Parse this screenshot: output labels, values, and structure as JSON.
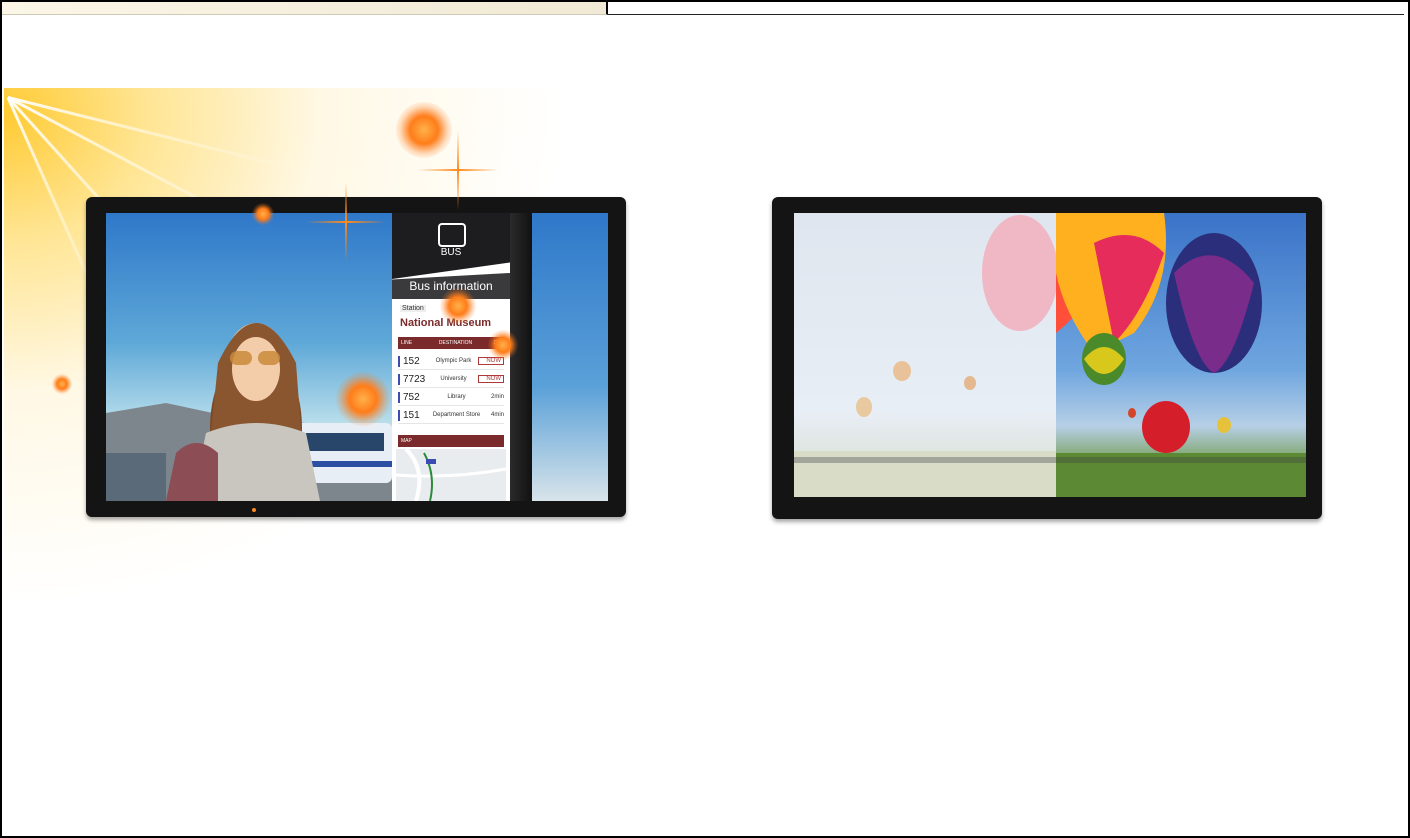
{
  "bus_screen": {
    "icon_label": "BUS",
    "title": "Bus information",
    "station_label": "Station",
    "station_name": "National Museum",
    "columns": [
      "LINE",
      "DESTINATION",
      "DUE"
    ],
    "rows": [
      {
        "line": "152",
        "destination": "Olympic Park",
        "due": "NOW"
      },
      {
        "line": "7723",
        "destination": "University",
        "due": "NOW"
      },
      {
        "line": "752",
        "destination": "Library",
        "due": "2min"
      },
      {
        "line": "151",
        "destination": "Department Store",
        "due": "4min"
      }
    ],
    "map_label": "MAP"
  },
  "colors": {
    "bezel": "#141414",
    "accent_red": "#7a2a2a",
    "sun": "#ffc62a",
    "flare": "#ff7d1a",
    "sky": "#3f8fd6"
  }
}
